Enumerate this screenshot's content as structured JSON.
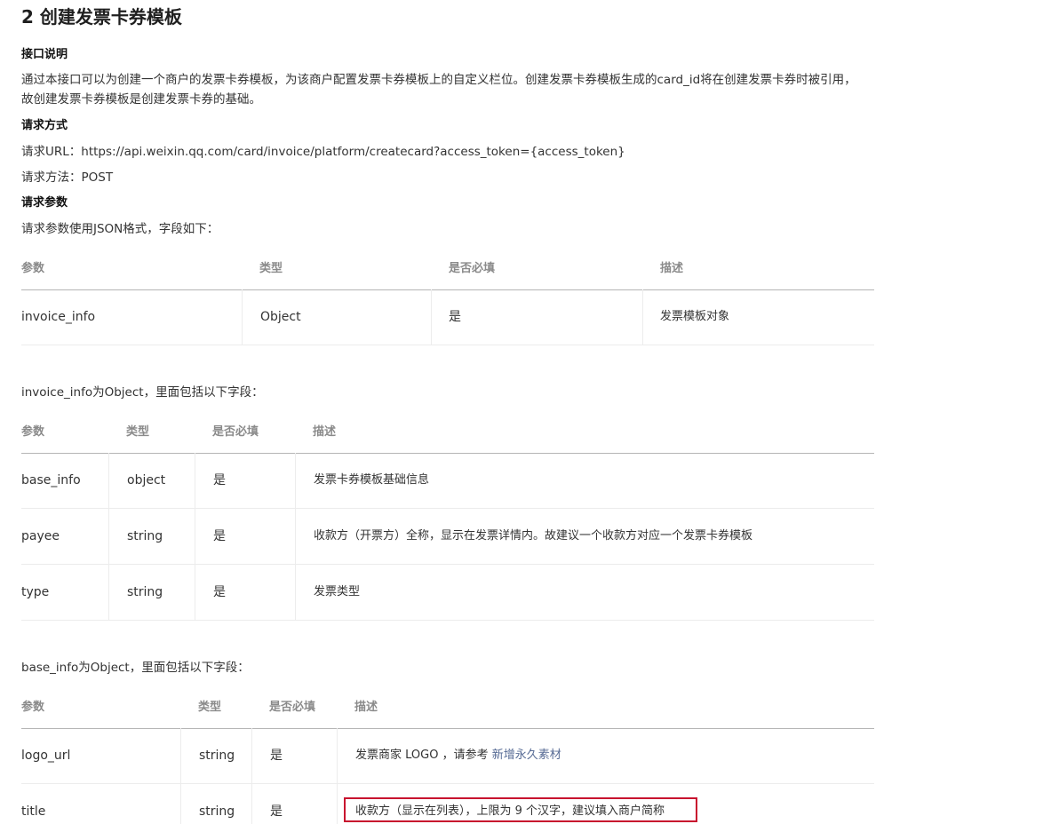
{
  "page_title": "2 创建发票卡券模板",
  "intro": {
    "heading": "接口说明",
    "text": "通过本接口可以为创建一个商户的发票卡券模板，为该商户配置发票卡券模板上的自定义栏位。创建发票卡券模板生成的card_id将在创建发票卡券时被引用，故创建发票卡券模板是创建发票卡券的基础。"
  },
  "request": {
    "heading": "请求方式",
    "url": "请求URL：https://api.weixin.qq.com/card/invoice/platform/createcard?access_token={access_token}",
    "method": "请求方法：POST"
  },
  "params": {
    "heading": "请求参数",
    "intro": "请求参数使用JSON格式，字段如下："
  },
  "table1": {
    "headers": [
      "参数",
      "类型",
      "是否必填",
      "描述"
    ],
    "rows": [
      [
        "invoice_info",
        "Object",
        "是",
        "发票模板对象"
      ]
    ]
  },
  "table2": {
    "intro": "invoice_info为Object，里面包括以下字段：",
    "headers": [
      "参数",
      "类型",
      "是否必填",
      "描述"
    ],
    "rows": [
      [
        "base_info",
        "object",
        "是",
        "发票卡券模板基础信息"
      ],
      [
        "payee",
        "string",
        "是",
        "收款方（开票方）全称，显示在发票详情内。故建议一个收款方对应一个发票卡券模板"
      ],
      [
        "type",
        "string",
        "是",
        "发票类型"
      ]
    ]
  },
  "table3": {
    "intro": "base_info为Object，里面包括以下字段：",
    "headers": [
      "参数",
      "类型",
      "是否必填",
      "描述"
    ],
    "rows": [
      {
        "param": "logo_url",
        "type": "string",
        "required": "是",
        "desc_prefix": "发票商家 LOGO ，请参考 ",
        "desc_link": "新增永久素材"
      },
      {
        "param": "title",
        "type": "string",
        "required": "是",
        "desc": "收款方（显示在列表），上限为 9 个汉字，建议填入商户简称"
      }
    ]
  },
  "colors": {
    "link": "#576b95",
    "highlight_border": "#c8102e",
    "header_text": "#8a8a8a"
  }
}
